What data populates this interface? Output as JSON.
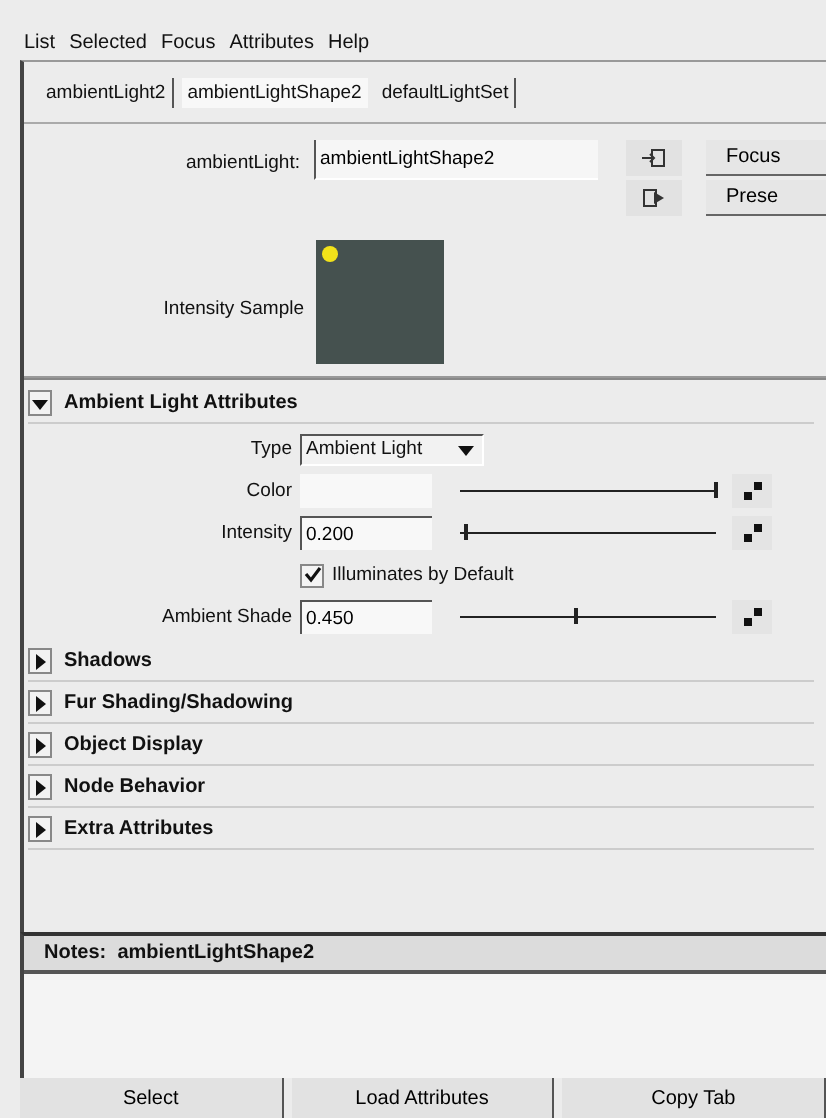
{
  "menu": [
    "List",
    "Selected",
    "Focus",
    "Attributes",
    "Help"
  ],
  "tabs": [
    {
      "label": "ambientLight2",
      "selected": false
    },
    {
      "label": "ambientLightShape2",
      "selected": true
    },
    {
      "label": "defaultLightSet",
      "selected": false
    }
  ],
  "node": {
    "label": "ambientLight:",
    "value": "ambientLightShape2",
    "buttons": [
      "Focus",
      "Prese"
    ]
  },
  "sample": {
    "label": "Intensity Sample"
  },
  "sections": [
    {
      "title": "Ambient Light Attributes",
      "expanded": true,
      "rows": [
        {
          "kind": "dropdown",
          "label": "Type",
          "value": "Ambient Light"
        },
        {
          "kind": "color",
          "label": "Color",
          "level": 1.0
        },
        {
          "kind": "number",
          "label": "Intensity",
          "value": "0.200",
          "level": 0.02
        },
        {
          "kind": "checkbox",
          "label": "Illuminates by Default",
          "checked": true
        },
        {
          "kind": "number",
          "label": "Ambient Shade",
          "value": "0.450",
          "level": 0.45
        }
      ]
    },
    {
      "title": "Shadows",
      "expanded": false
    },
    {
      "title": "Fur Shading/Shadowing",
      "expanded": false
    },
    {
      "title": "Object Display",
      "expanded": false
    },
    {
      "title": "Node Behavior",
      "expanded": false
    },
    {
      "title": "Extra Attributes",
      "expanded": false
    }
  ],
  "notes": {
    "label": "Notes:",
    "node": "ambientLightShape2"
  },
  "buttons": [
    "Select",
    "Load Attributes",
    "Copy Tab"
  ]
}
